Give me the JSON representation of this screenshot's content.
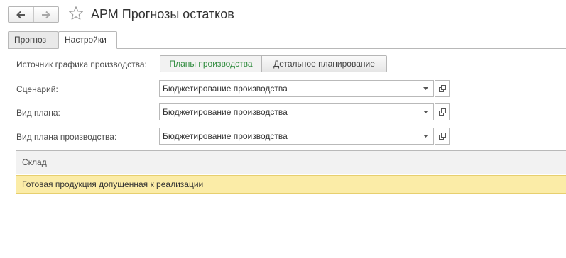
{
  "window": {
    "title": "АРМ Прогнозы остатков",
    "back_icon": "arrow-left-icon",
    "forward_icon": "arrow-right-icon",
    "favorite_icon": "star-outline-icon"
  },
  "tabs": [
    {
      "label": "Прогноз",
      "active": false
    },
    {
      "label": "Настройки",
      "active": true
    }
  ],
  "form": {
    "source": {
      "label": "Источник графика производства:",
      "options": [
        "Планы производства",
        "Детальное планирование"
      ],
      "selected": "Планы производства"
    },
    "scenario": {
      "label": "Сценарий:",
      "value": "Бюджетирование производства"
    },
    "plan_type": {
      "label": "Вид плана:",
      "value": "Бюджетирование производства"
    },
    "production_plan_type": {
      "label": "Вид плана производства:",
      "value": "Бюджетирование производства"
    }
  },
  "table": {
    "columns": [
      "Склад"
    ],
    "rows": [
      "Готовая продукция допущенная к реализации"
    ],
    "selected_row_color": "#fbeca7"
  },
  "colors": {
    "accent_green": "#2f8b3d",
    "selection": "#fbeca7"
  }
}
